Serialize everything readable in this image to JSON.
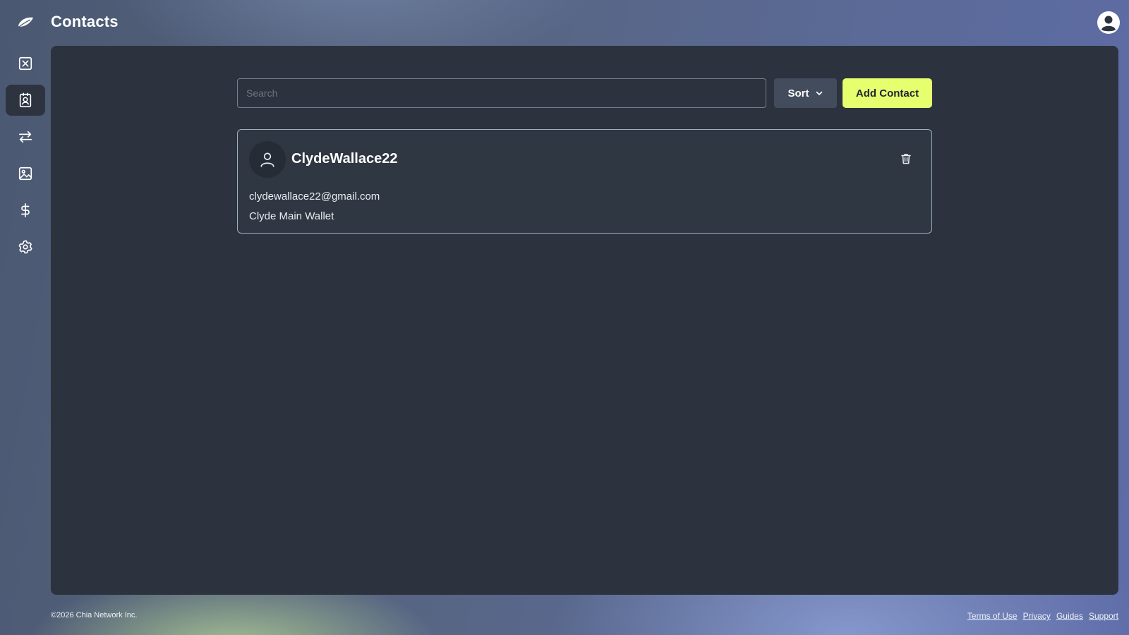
{
  "header": {
    "title": "Contacts",
    "logo_icon": "chia-leaf-icon",
    "profile_icon": "user-circle-icon"
  },
  "sidebar": {
    "items": [
      {
        "name": "tokens",
        "icon": "box-x-icon",
        "active": false
      },
      {
        "name": "contacts",
        "icon": "contact-card-icon",
        "active": true
      },
      {
        "name": "transactions",
        "icon": "arrows-swap-icon",
        "active": false
      },
      {
        "name": "nfts",
        "icon": "image-icon",
        "active": false
      },
      {
        "name": "offers",
        "icon": "dollar-icon",
        "active": false
      },
      {
        "name": "settings",
        "icon": "gear-icon",
        "active": false
      }
    ]
  },
  "toolbar": {
    "search_placeholder": "Search",
    "search_value": "",
    "sort_label": "Sort",
    "add_contact_label": "Add Contact"
  },
  "contacts": [
    {
      "name": "ClydeWallace22",
      "email": "clydewallace22@gmail.com",
      "wallet": "Clyde Main Wallet"
    }
  ],
  "footer": {
    "copyright": "©2026 Chia Network Inc.",
    "links": [
      "Terms of Use",
      "Privacy",
      "Guides",
      "Support"
    ]
  },
  "colors": {
    "accent": "#e6ff6e",
    "panel": "#2c333e",
    "sort_button": "#434c5c",
    "card_border": "#a2aebe"
  }
}
